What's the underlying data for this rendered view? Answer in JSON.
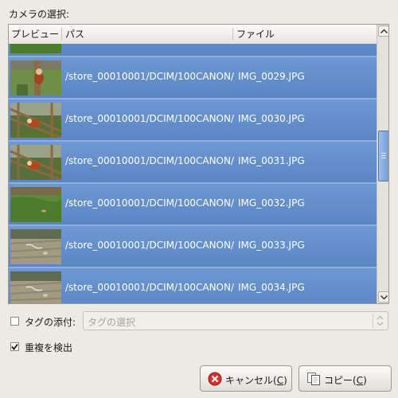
{
  "title": "カメラの選択:",
  "columns": {
    "preview": "プレビュー",
    "path": "パス",
    "file": "ファイル"
  },
  "rows": [
    {
      "path": "",
      "file": "",
      "scene": "grass"
    },
    {
      "path": "/store_00010001/DCIM/100CANON/",
      "file": "IMG_0029.JPG",
      "scene": "redpanda-post"
    },
    {
      "path": "/store_00010001/DCIM/100CANON/",
      "file": "IMG_0030.JPG",
      "scene": "redpanda-fence"
    },
    {
      "path": "/store_00010001/DCIM/100CANON/",
      "file": "IMG_0031.JPG",
      "scene": "redpanda-fence"
    },
    {
      "path": "/store_00010001/DCIM/100CANON/",
      "file": "IMG_0032.JPG",
      "scene": "grass"
    },
    {
      "path": "/store_00010001/DCIM/100CANON/",
      "file": "IMG_0033.JPG",
      "scene": "dirt"
    },
    {
      "path": "/store_00010001/DCIM/100CANON/",
      "file": "IMG_0034.JPG",
      "scene": "dirt"
    }
  ],
  "tag": {
    "label": "タグの添付:",
    "placeholder": "タグの選択",
    "checked": false
  },
  "detect_duplicates": {
    "label": "重複を検出",
    "checked": true
  },
  "buttons": {
    "cancel": {
      "label": "キャンセル(",
      "mnemonic": "C",
      "close": ")"
    },
    "copy": {
      "label": "コピー(",
      "mnemonic": "C",
      "close": ")"
    }
  },
  "colors": {
    "selection": "#5a86c4",
    "text_on_selection": "#ffffff"
  },
  "icons": {
    "cancel": "cancel-icon",
    "copy": "copy-icon"
  }
}
